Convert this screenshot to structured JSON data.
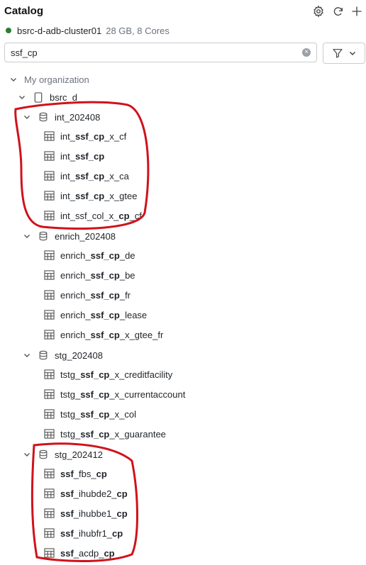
{
  "header": {
    "title": "Catalog",
    "icons": [
      "gear-icon",
      "refresh-icon",
      "plus-icon"
    ]
  },
  "cluster": {
    "name": "bsrc-d-adb-cluster01",
    "meta": "28 GB, 8 Cores",
    "status_color": "#2e7d32"
  },
  "search": {
    "value": "ssf_cp"
  },
  "tree": {
    "org": {
      "label": "My organization"
    },
    "catalog": {
      "label": "bsrc_d"
    },
    "schemas": [
      {
        "label": "int_202408",
        "tables": [
          {
            "pre": "int_",
            "hit": "ssf_cp",
            "post": "_x_cf"
          },
          {
            "pre": "int_",
            "hit": "ssf_cp",
            "post": ""
          },
          {
            "pre": "int_",
            "hit": "ssf_cp",
            "post": "_x_ca"
          },
          {
            "pre": "int_",
            "hit": "ssf_cp",
            "post": "_x_gtee"
          },
          {
            "pre": "int_ssf_col_x_",
            "hit": "cp",
            "post": "_cf"
          }
        ]
      },
      {
        "label": "enrich_202408",
        "tables": [
          {
            "pre": "enrich_",
            "hit": "ssf_cp",
            "post": "_de"
          },
          {
            "pre": "enrich_",
            "hit": "ssf_cp",
            "post": "_be"
          },
          {
            "pre": "enrich_",
            "hit": "ssf_cp",
            "post": "_fr"
          },
          {
            "pre": "enrich_",
            "hit": "ssf_cp",
            "post": "_lease"
          },
          {
            "pre": "enrich_",
            "hit": "ssf_cp",
            "post": "_x_gtee_fr"
          }
        ]
      },
      {
        "label": "stg_202408",
        "tables": [
          {
            "pre": "tstg_",
            "hit": "ssf_cp",
            "post": "_x_creditfacility"
          },
          {
            "pre": "tstg_",
            "hit": "ssf_cp",
            "post": "_x_currentaccount"
          },
          {
            "pre": "tstg_",
            "hit": "ssf_cp",
            "post": "_x_col"
          },
          {
            "pre": "tstg_",
            "hit": "ssf_cp",
            "post": "_x_guarantee"
          }
        ]
      },
      {
        "label": "stg_202412",
        "tables": [
          {
            "pre": "",
            "hit": "ssf",
            "post": "_fbs_",
            "hit2": "cp"
          },
          {
            "pre": "",
            "hit": "ssf",
            "post": "_ihubde2_",
            "hit2": "cp"
          },
          {
            "pre": "",
            "hit": "ssf",
            "post": "_ihubbe1_",
            "hit2": "cp"
          },
          {
            "pre": "",
            "hit": "ssf",
            "post": "_ihubfr1_",
            "hit2": "cp"
          },
          {
            "pre": "",
            "hit": "ssf",
            "post": "_acdp_",
            "hit2": "cp"
          }
        ]
      }
    ]
  },
  "annotation_color": "#d0121b"
}
